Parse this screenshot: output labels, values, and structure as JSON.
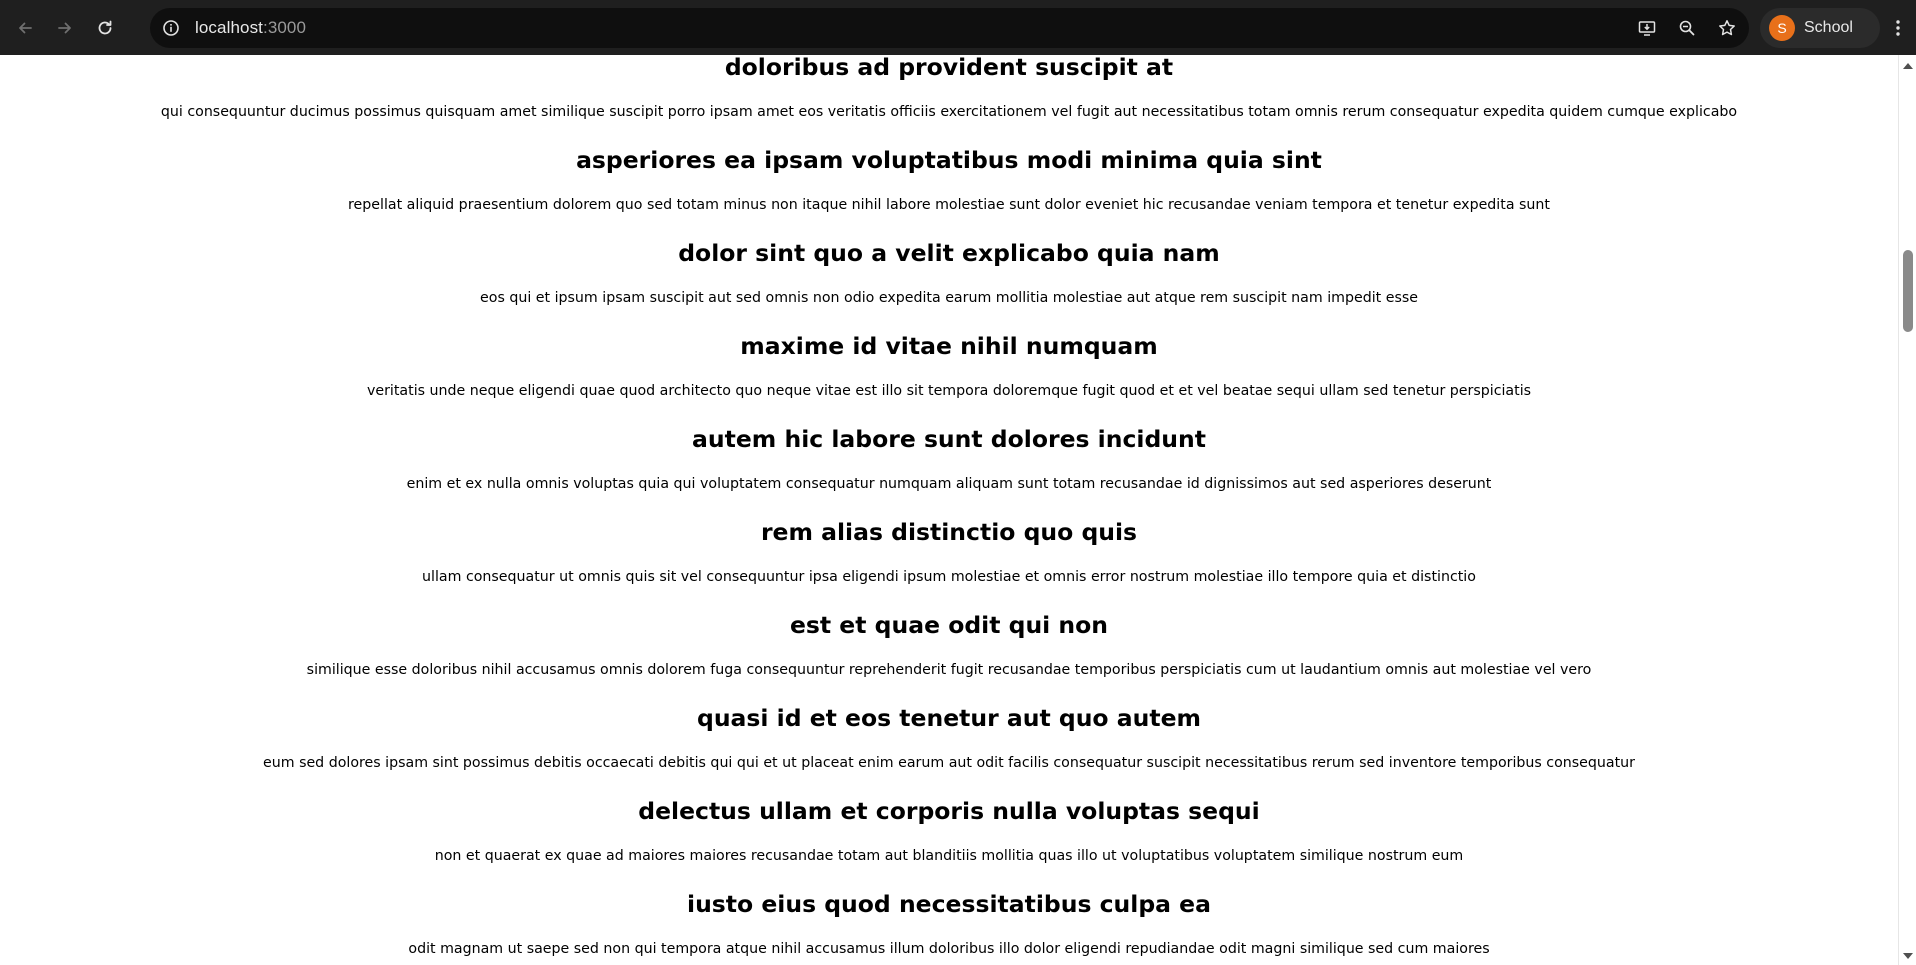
{
  "browser": {
    "url_host": "localhost",
    "url_port": ":3000",
    "profile_initial": "S",
    "profile_name": "School",
    "icons": {
      "back": "arrow-left-icon",
      "forward": "arrow-right-icon",
      "reload": "reload-icon",
      "site_info": "info-icon",
      "install": "install-app-icon",
      "zoom": "zoom-out-icon",
      "bookmark": "star-icon",
      "menu": "kebab-menu-icon"
    },
    "avatar_color": "#e8701a"
  },
  "posts": [
    {
      "title": "doloribus ad provident suscipit at",
      "body": "qui consequuntur ducimus possimus quisquam amet similique suscipit porro ipsam amet eos veritatis officiis exercitationem vel fugit aut necessitatibus totam omnis rerum consequatur expedita quidem cumque explicabo"
    },
    {
      "title": "asperiores ea ipsam voluptatibus modi minima quia sint",
      "body": "repellat aliquid praesentium dolorem quo sed totam minus non itaque nihil labore molestiae sunt dolor eveniet hic recusandae veniam tempora et tenetur expedita sunt"
    },
    {
      "title": "dolor sint quo a velit explicabo quia nam",
      "body": "eos qui et ipsum ipsam suscipit aut sed omnis non odio expedita earum mollitia molestiae aut atque rem suscipit nam impedit esse"
    },
    {
      "title": "maxime id vitae nihil numquam",
      "body": "veritatis unde neque eligendi quae quod architecto quo neque vitae est illo sit tempora doloremque fugit quod et et vel beatae sequi ullam sed tenetur perspiciatis"
    },
    {
      "title": "autem hic labore sunt dolores incidunt",
      "body": "enim et ex nulla omnis voluptas quia qui voluptatem consequatur numquam aliquam sunt totam recusandae id dignissimos aut sed asperiores deserunt"
    },
    {
      "title": "rem alias distinctio quo quis",
      "body": "ullam consequatur ut omnis quis sit vel consequuntur ipsa eligendi ipsum molestiae et omnis error nostrum molestiae illo tempore quia et distinctio"
    },
    {
      "title": "est et quae odit qui non",
      "body": "similique esse doloribus nihil accusamus omnis dolorem fuga consequuntur reprehenderit fugit recusandae temporibus perspiciatis cum ut laudantium omnis aut molestiae vel vero"
    },
    {
      "title": "quasi id et eos tenetur aut quo autem",
      "body": "eum sed dolores ipsam sint possimus debitis occaecati debitis qui qui et ut placeat enim earum aut odit facilis consequatur suscipit necessitatibus rerum sed inventore temporibus consequatur"
    },
    {
      "title": "delectus ullam et corporis nulla voluptas sequi",
      "body": "non et quaerat ex quae ad maiores maiores recusandae totam aut blanditiis mollitia quas illo ut voluptatibus voluptatem similique nostrum eum"
    },
    {
      "title": "iusto eius quod necessitatibus culpa ea",
      "body": "odit magnam ut saepe sed non qui tempora atque nihil accusamus illum doloribus illo dolor eligendi repudiandae odit magni similique sed cum maiores"
    }
  ]
}
